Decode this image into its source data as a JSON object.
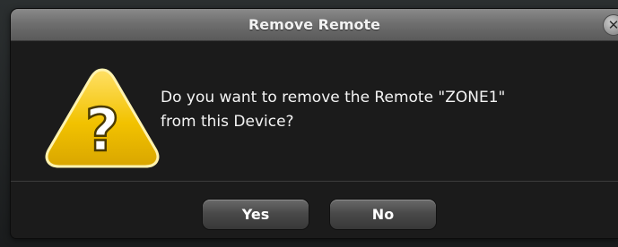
{
  "dialog": {
    "title": "Remove Remote",
    "close_glyph": "✕",
    "message_line1": "Do you want to remove the Remote \"ZONE1\"",
    "message_line2": "from this Device?",
    "icon": "question-warning-icon",
    "icon_glyph": "?",
    "buttons": {
      "yes_label": "Yes",
      "no_label": "No"
    }
  },
  "colors": {
    "warning_yellow": "#f2c200",
    "dialog_background": "#1b1b1b",
    "titlebar_gray": "#7a7a7a"
  }
}
